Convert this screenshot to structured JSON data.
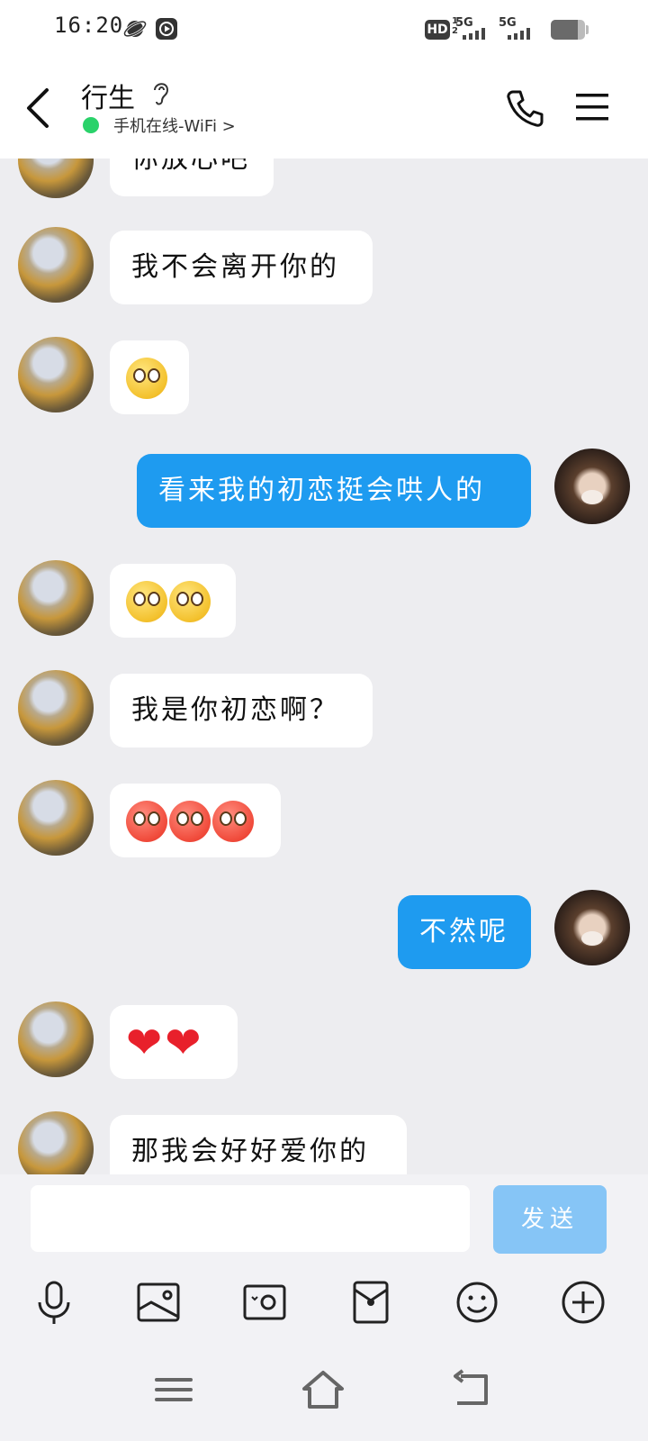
{
  "status_bar": {
    "time": "16:20",
    "hd_label": "HD",
    "sim1": "5G",
    "sim2": "5G",
    "battery_level": 0.8
  },
  "header": {
    "contact_name": "行生",
    "online_status": "手机在线-WiFi >"
  },
  "messages": [
    {
      "from": "other",
      "text": "你放心吧"
    },
    {
      "from": "other",
      "text": "我不会离开你的"
    },
    {
      "from": "other",
      "emoji": [
        "pleading-face-emoji"
      ]
    },
    {
      "from": "me",
      "text": "看来我的初恋挺会哄人的"
    },
    {
      "from": "other",
      "emoji": [
        "flushed-face-emoji",
        "flushed-face-emoji"
      ]
    },
    {
      "from": "other",
      "text": "我是你初恋啊？"
    },
    {
      "from": "other",
      "emoji": [
        "sweat-face-emoji",
        "sweat-face-emoji",
        "sweat-face-emoji"
      ]
    },
    {
      "from": "me",
      "text": "不然呢"
    },
    {
      "from": "other",
      "emoji": [
        "heart-emoji",
        "heart-emoji"
      ]
    },
    {
      "from": "other",
      "text": "那我会好好爱你的"
    }
  ],
  "input": {
    "placeholder": "",
    "send_label": "发送"
  },
  "toolbar": {
    "icons": [
      "microphone-icon",
      "image-icon",
      "camera-icon",
      "red-packet-icon",
      "emoji-icon",
      "plus-icon"
    ]
  },
  "colors": {
    "outgoing_bubble": "#1e9bf0",
    "incoming_bubble": "#ffffff",
    "chat_background": "#ededf0",
    "send_button": "#86c5f6",
    "online_dot": "#2ad26a"
  }
}
